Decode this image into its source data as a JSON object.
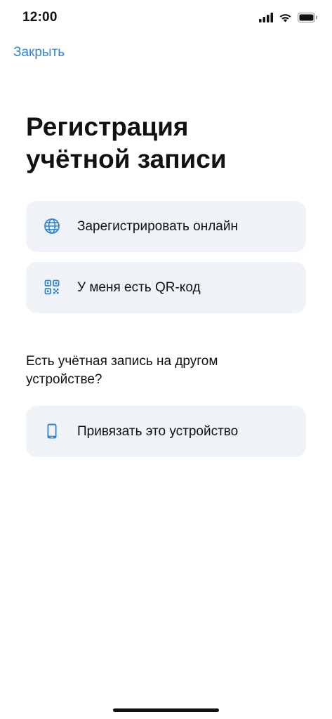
{
  "status_bar": {
    "time": "12:00",
    "icons": [
      "cellular-signal-icon",
      "wifi-icon",
      "battery-icon"
    ]
  },
  "nav": {
    "close_label": "Закрыть"
  },
  "page": {
    "title_line1": "Регистрация",
    "title_line2": "учётной записи"
  },
  "options": [
    {
      "label": "Зарегистрировать онлайн",
      "icon": "globe-icon"
    },
    {
      "label": "У меня есть QR-код",
      "icon": "qr-code-icon"
    }
  ],
  "other_device": {
    "question": "Есть учётная запись на другом устройстве?",
    "button_label": "Привязать это устройство",
    "icon": "smartphone-icon"
  },
  "colors": {
    "accent": "#2f86d6",
    "card_background": "#eff2f7",
    "text": "#111111",
    "background": "#ffffff"
  }
}
